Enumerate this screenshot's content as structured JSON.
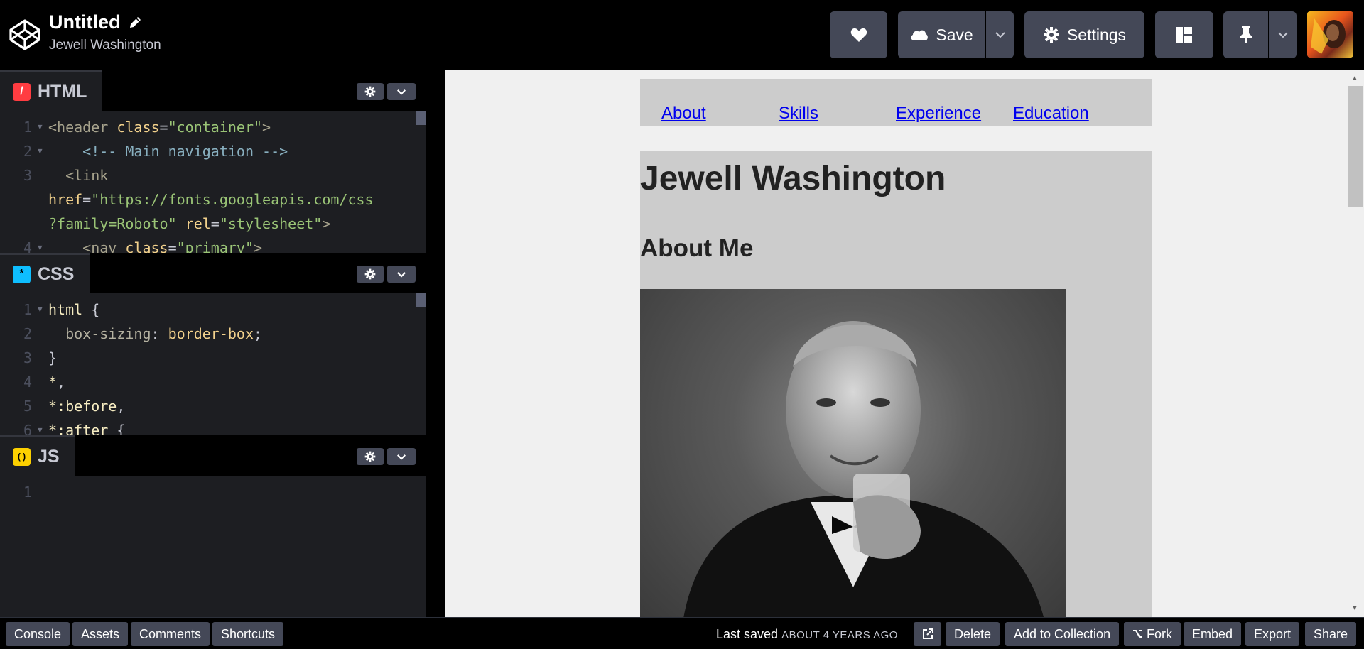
{
  "header": {
    "title": "Untitled",
    "author": "Jewell Washington",
    "save_label": "Save",
    "settings_label": "Settings"
  },
  "editors": {
    "html": {
      "label": "HTML",
      "badge": "/",
      "lines": [
        {
          "n": "1",
          "fold": true,
          "segments": [
            {
              "c": "tag",
              "t": "<header "
            },
            {
              "c": "attr",
              "t": "class"
            },
            {
              "c": "txt",
              "t": "="
            },
            {
              "c": "str",
              "t": "\"container\""
            },
            {
              "c": "tag",
              "t": ">"
            }
          ]
        },
        {
          "n": "2",
          "fold": true,
          "segments": [
            {
              "c": "cmt",
              "t": "    <!-- Main navigation -->"
            }
          ]
        },
        {
          "n": "3",
          "fold": false,
          "segments": [
            {
              "c": "tag",
              "t": "  <link"
            }
          ]
        },
        {
          "n": "",
          "fold": false,
          "segments": [
            {
              "c": "attr",
              "t": "href"
            },
            {
              "c": "txt",
              "t": "="
            },
            {
              "c": "str",
              "t": "\"https://fonts.googleapis.com/css"
            }
          ]
        },
        {
          "n": "",
          "fold": false,
          "segments": [
            {
              "c": "str",
              "t": "?family=Roboto\""
            },
            {
              "c": "txt",
              "t": " "
            },
            {
              "c": "attr",
              "t": "rel"
            },
            {
              "c": "txt",
              "t": "="
            },
            {
              "c": "str",
              "t": "\"stylesheet\""
            },
            {
              "c": "tag",
              "t": ">"
            }
          ]
        },
        {
          "n": "4",
          "fold": true,
          "segments": [
            {
              "c": "tag",
              "t": "    <nav "
            },
            {
              "c": "attr",
              "t": "class"
            },
            {
              "c": "txt",
              "t": "="
            },
            {
              "c": "str",
              "t": "\"primary\""
            },
            {
              "c": "tag",
              "t": ">"
            }
          ]
        }
      ]
    },
    "css": {
      "label": "CSS",
      "badge": "*",
      "lines": [
        {
          "n": "1",
          "fold": true,
          "segments": [
            {
              "c": "sel",
              "t": "html "
            },
            {
              "c": "txt",
              "t": "{"
            }
          ]
        },
        {
          "n": "2",
          "fold": false,
          "segments": [
            {
              "c": "prop",
              "t": "  box-sizing"
            },
            {
              "c": "txt",
              "t": ": "
            },
            {
              "c": "val",
              "t": "border-box"
            },
            {
              "c": "txt",
              "t": ";"
            }
          ]
        },
        {
          "n": "3",
          "fold": false,
          "segments": [
            {
              "c": "txt",
              "t": "}"
            }
          ]
        },
        {
          "n": "4",
          "fold": false,
          "segments": [
            {
              "c": "sel",
              "t": "*"
            },
            {
              "c": "txt",
              "t": ","
            }
          ]
        },
        {
          "n": "5",
          "fold": false,
          "segments": [
            {
              "c": "sel",
              "t": "*:before"
            },
            {
              "c": "txt",
              "t": ","
            }
          ]
        },
        {
          "n": "6",
          "fold": true,
          "segments": [
            {
              "c": "sel",
              "t": "*:after "
            },
            {
              "c": "txt",
              "t": "{"
            }
          ]
        }
      ]
    },
    "js": {
      "label": "JS",
      "badge": "( )",
      "lines": [
        {
          "n": "1",
          "fold": false,
          "segments": []
        }
      ]
    }
  },
  "preview": {
    "nav_links": [
      "About",
      "Skills",
      "Experience",
      "Education"
    ],
    "name": "Jewell Washington",
    "about_heading": "About Me"
  },
  "footer": {
    "left_buttons": [
      "Console",
      "Assets",
      "Comments",
      "Shortcuts"
    ],
    "last_saved_label": "Last saved",
    "last_saved_when": "ABOUT 4 YEARS AGO",
    "delete_label": "Delete",
    "collection_label": "Add to Collection",
    "fork_label": "Fork",
    "embed_label": "Embed",
    "export_label": "Export",
    "share_label": "Share"
  },
  "colors": {
    "html_badge": "#ff3c41",
    "css_badge": "#0ebeff",
    "js_badge": "#fcd000",
    "button_bg": "#444857"
  },
  "icons": [
    "codepen-logo-icon",
    "pencil-icon",
    "heart-icon",
    "cloud-icon",
    "chevron-down-icon",
    "gear-icon",
    "layout-icon",
    "pin-icon",
    "external-link-icon",
    "fork-icon"
  ]
}
